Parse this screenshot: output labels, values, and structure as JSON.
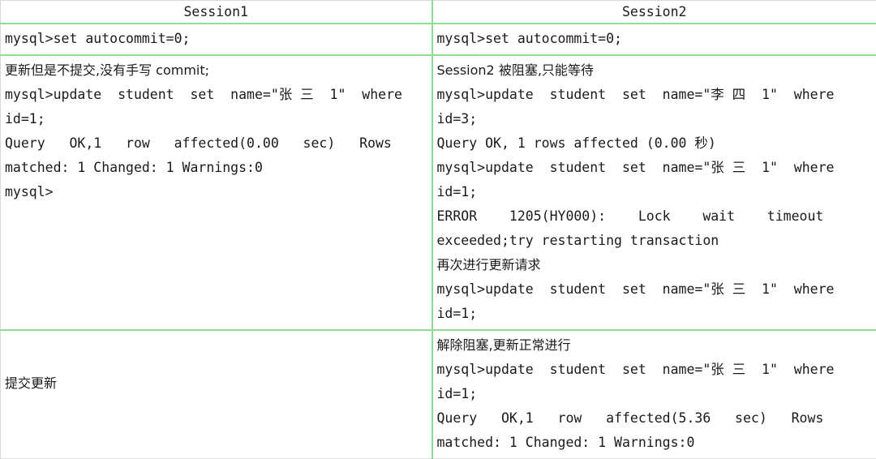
{
  "table": {
    "columns": [
      {
        "id": "session1",
        "header": "Session1"
      },
      {
        "id": "session2",
        "header": "Session2"
      }
    ],
    "rows": [
      {
        "id": "row-autocommit",
        "session1": {
          "lines": [
            {
              "text": "mysql>set autocommit=0;",
              "style": "mono"
            }
          ]
        },
        "session2": {
          "lines": [
            {
              "text": "mysql>set autocommit=0;",
              "style": "mono"
            }
          ]
        }
      },
      {
        "id": "row-update-no-commit",
        "session1": {
          "lines": [
            {
              "text": "更新但是不提交,没有手写 commit;",
              "style": "cn"
            },
            {
              "text": "mysql>update  student  set  name=\"张 三  1\"  where",
              "style": "mono"
            },
            {
              "text": "id=1;",
              "style": "mono"
            },
            {
              "text": "Query   OK,1   row   affected(0.00   sec)   Rows",
              "style": "mono"
            },
            {
              "text": "matched: 1 Changed: 1 Warnings:0",
              "style": "mono"
            },
            {
              "text": "mysql>",
              "style": "mono"
            }
          ]
        },
        "session2": {
          "lines": [
            {
              "text": "Session2 被阻塞,只能等待",
              "style": "cn"
            },
            {
              "text": "mysql>update  student  set  name=\"李 四  1\"  where",
              "style": "mono"
            },
            {
              "text": "id=3;",
              "style": "mono"
            },
            {
              "text": "Query OK, 1 rows affected (0.00 秒)",
              "style": "mono"
            },
            {
              "text": "mysql>update  student  set  name=\"张 三  1\"  where",
              "style": "mono"
            },
            {
              "text": "id=1;",
              "style": "mono"
            },
            {
              "text": "ERROR    1205(HY000):    Lock    wait    timeout",
              "style": "mono"
            },
            {
              "text": "exceeded;try restarting transaction",
              "style": "mono"
            },
            {
              "text": "再次进行更新请求",
              "style": "cn"
            },
            {
              "text": "mysql>update  student  set  name=\"张 三  1\"  where",
              "style": "mono"
            },
            {
              "text": "id=1;",
              "style": "mono"
            }
          ]
        }
      },
      {
        "id": "row-commit",
        "session1": {
          "lines": [
            {
              "text": "提交更新",
              "style": "cn"
            }
          ]
        },
        "session2": {
          "lines": [
            {
              "text": "解除阻塞,更新正常进行",
              "style": "cn"
            },
            {
              "text": "mysql>update  student  set  name=\"张 三  1\"  where",
              "style": "mono"
            },
            {
              "text": "id=1;",
              "style": "mono"
            },
            {
              "text": "Query   OK,1   row   affected(5.36   sec)   Rows",
              "style": "mono"
            },
            {
              "text": "matched: 1 Changed: 1 Warnings:0",
              "style": "mono"
            }
          ]
        }
      }
    ]
  },
  "colors": {
    "grid_green": "#8ede8e",
    "grid_grey": "#d9d9d9",
    "text": "#1a1a1a",
    "background": "#ffffff"
  }
}
